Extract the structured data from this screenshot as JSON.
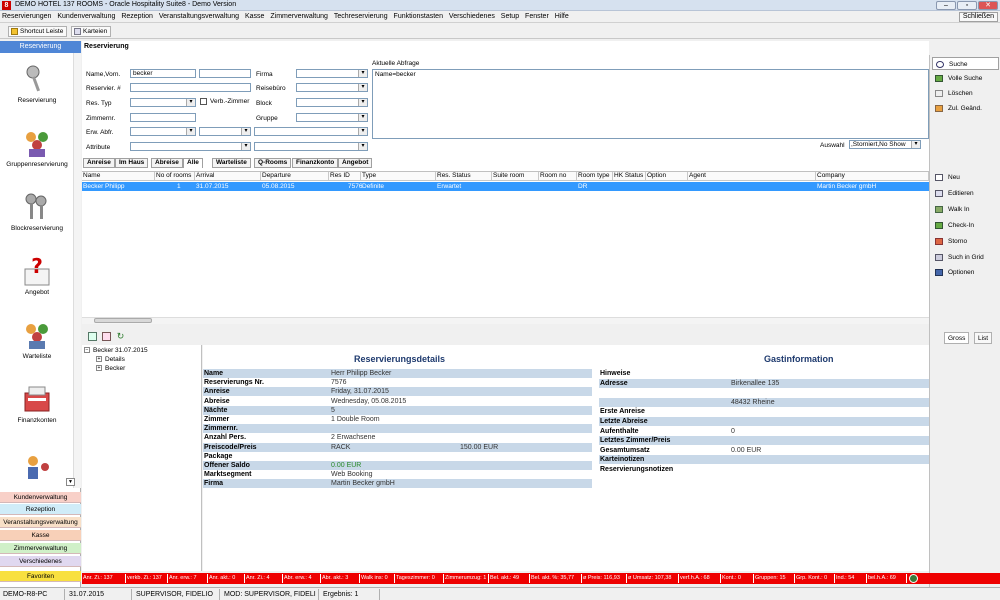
{
  "window": {
    "title": "DEMO HOTEL 137 ROOMS - Oracle Hospitality Suite8 - Demo Version",
    "logo_letter": "8",
    "close_label": "Schließen"
  },
  "menu": [
    "Reservierungen",
    "Kundenverwaltung",
    "Rezeption",
    "Veranstaltungsverwaltung",
    "Kasse",
    "Zimmerverwaltung",
    "Techreservierung",
    "Funktionstasten",
    "Verschiedenes",
    "Setup",
    "Fenster",
    "Hilfe"
  ],
  "toolbar": {
    "shortcut_label": "Shortcut Leiste",
    "karteien_label": "Karteien"
  },
  "left_nav": {
    "header": "Reservierung",
    "icons": [
      "Reservierung",
      "Gruppenreservierung",
      "Blockreservierung",
      "Angebot",
      "Warteliste",
      "Finanzkonten"
    ],
    "categories": [
      "Kundenverwaltung",
      "Rezeption",
      "Veranstaltungsverwaltung",
      "Kasse",
      "Zimmerverwaltung",
      "Verschiedenes",
      "Favoriten"
    ]
  },
  "search": {
    "section_title": "Reservierung",
    "name_label": "Name,Vorn.",
    "name_value": "becker",
    "reservier_label": "Reservier. #",
    "restyp_label": "Res. Typ",
    "verb_label": "Verb.-Zimmer",
    "zimmernr_label": "Zimmernr.",
    "erwabfr_label": "Erw. Abfr.",
    "attribute_label": "Attribute",
    "firma_label": "Firma",
    "reisebuero_label": "Reisebüro",
    "block_label": "Block",
    "gruppe_label": "Gruppe",
    "aktuelle_label": "Aktuelle Abfrage",
    "aktuelle_value": "Name=becker",
    "auswahl_label": "Auswahl",
    "auswahl_value": ",Storniert,No Show"
  },
  "tabs": [
    "Anreise",
    "Im Haus",
    "Abreise",
    "Alle",
    "Warteliste",
    "Q-Rooms",
    "Finanzkonto",
    "Angebot"
  ],
  "grid": {
    "columns": [
      "Name",
      "No of rooms",
      "Arrival",
      "Departure",
      "Res ID",
      "Type",
      "Res. Status",
      "Suite room",
      "Room no",
      "Room type",
      "HK Status",
      "Option",
      "Agent",
      "Company"
    ],
    "row": {
      "name": "Becker Philipp",
      "rooms": "1",
      "arrival": "31.07.2015",
      "departure": "05.08.2015",
      "resid": "7576",
      "type": "Definite",
      "status": "Erwartet",
      "roomtype": "DR",
      "company": "Martin Becker gmbH"
    }
  },
  "right_buttons": [
    "Suche",
    "Volle Suche",
    "Löschen",
    "Zul. Geänd.",
    "Neu",
    "Editieren",
    "Walk In",
    "Check-In",
    "Storno",
    "Such in Grid",
    "Optionen"
  ],
  "tree": {
    "root": "Becker 31.07.2015",
    "child1": "Details",
    "child2": "Becker"
  },
  "view_tabs": [
    "Gross",
    "List"
  ],
  "reservation": {
    "header": "Reservierungsdetails",
    "rows": [
      {
        "k": "Name",
        "v": "Herr Philipp Becker"
      },
      {
        "k": "Reservierungs Nr.",
        "v": "7576"
      },
      {
        "k": "Anreise",
        "v": "Friday, 31.07.2015"
      },
      {
        "k": "Abreise",
        "v": "Wednesday, 05.08.2015"
      },
      {
        "k": "Nächte",
        "v": "5"
      },
      {
        "k": "Zimmer",
        "v": "1 Double Room"
      },
      {
        "k": "Zimmernr.",
        "v": ""
      },
      {
        "k": "Anzahl Pers.",
        "v": "2 Erwachsene"
      },
      {
        "k": "Preiscode/Preis",
        "v": "RACK"
      },
      {
        "k": "Package",
        "v": ""
      },
      {
        "k": "Offener Saldo",
        "v": "0.00 EUR"
      },
      {
        "k": "Marktsegment",
        "v": "Web Booking"
      },
      {
        "k": "Firma",
        "v": "Martin Becker gmbH"
      }
    ],
    "price_value": "150.00 EUR"
  },
  "guest": {
    "header": "Gastinformation",
    "rows": [
      {
        "k": "Hinweise",
        "v": ""
      },
      {
        "k": "Adresse",
        "v": "Birkenallee 135"
      },
      {
        "k": "",
        "v": ""
      },
      {
        "k": "",
        "v": "48432 Rheine"
      },
      {
        "k": "Erste Anreise",
        "v": ""
      },
      {
        "k": "Letzte Abreise",
        "v": ""
      },
      {
        "k": "Aufenthalte",
        "v": "0"
      },
      {
        "k": "Letztes Zimmer/Preis",
        "v": ""
      },
      {
        "k": "Gesamtumsatz",
        "v": "0.00 EUR"
      },
      {
        "k": "Karteinotizen",
        "v": ""
      },
      {
        "k": "Reservierungsnotizen",
        "v": ""
      }
    ]
  },
  "status_red": [
    "Anr. Zi.: 137",
    "verkb. Zi.: 137",
    "Anr. erw.: 7",
    "Anr. akt.: 0",
    "Anr. Zi.: 4",
    "Abr. erw.: 4",
    "Abr. akt.: 3",
    "Walk ins: 0",
    "Tageszimmer: 0",
    "Zimmerumzug: 1",
    "Bel. akt.: 49",
    "Bel. akt. %: 35,77",
    "ø Preis: 116,93",
    "ø Umsatz: 107,38",
    "verf.h.A.: 68",
    "Kont.: 0",
    "Gruppen: 15",
    "Grp. Kont.: 0",
    "Ind.: 54",
    "bel.h.A.: 69"
  ],
  "status_bottom": [
    "DEMO-R8-PC",
    "31.07.2015",
    "SUPERVISOR, FIDELIO",
    "MOD: SUPERVISOR, FIDELI",
    "Ergebnis: 1"
  ],
  "colors": {
    "accent": "#4f86d6",
    "selection": "#3399ff",
    "status_red": "#e00000",
    "section_header": "#1e3a6e"
  }
}
